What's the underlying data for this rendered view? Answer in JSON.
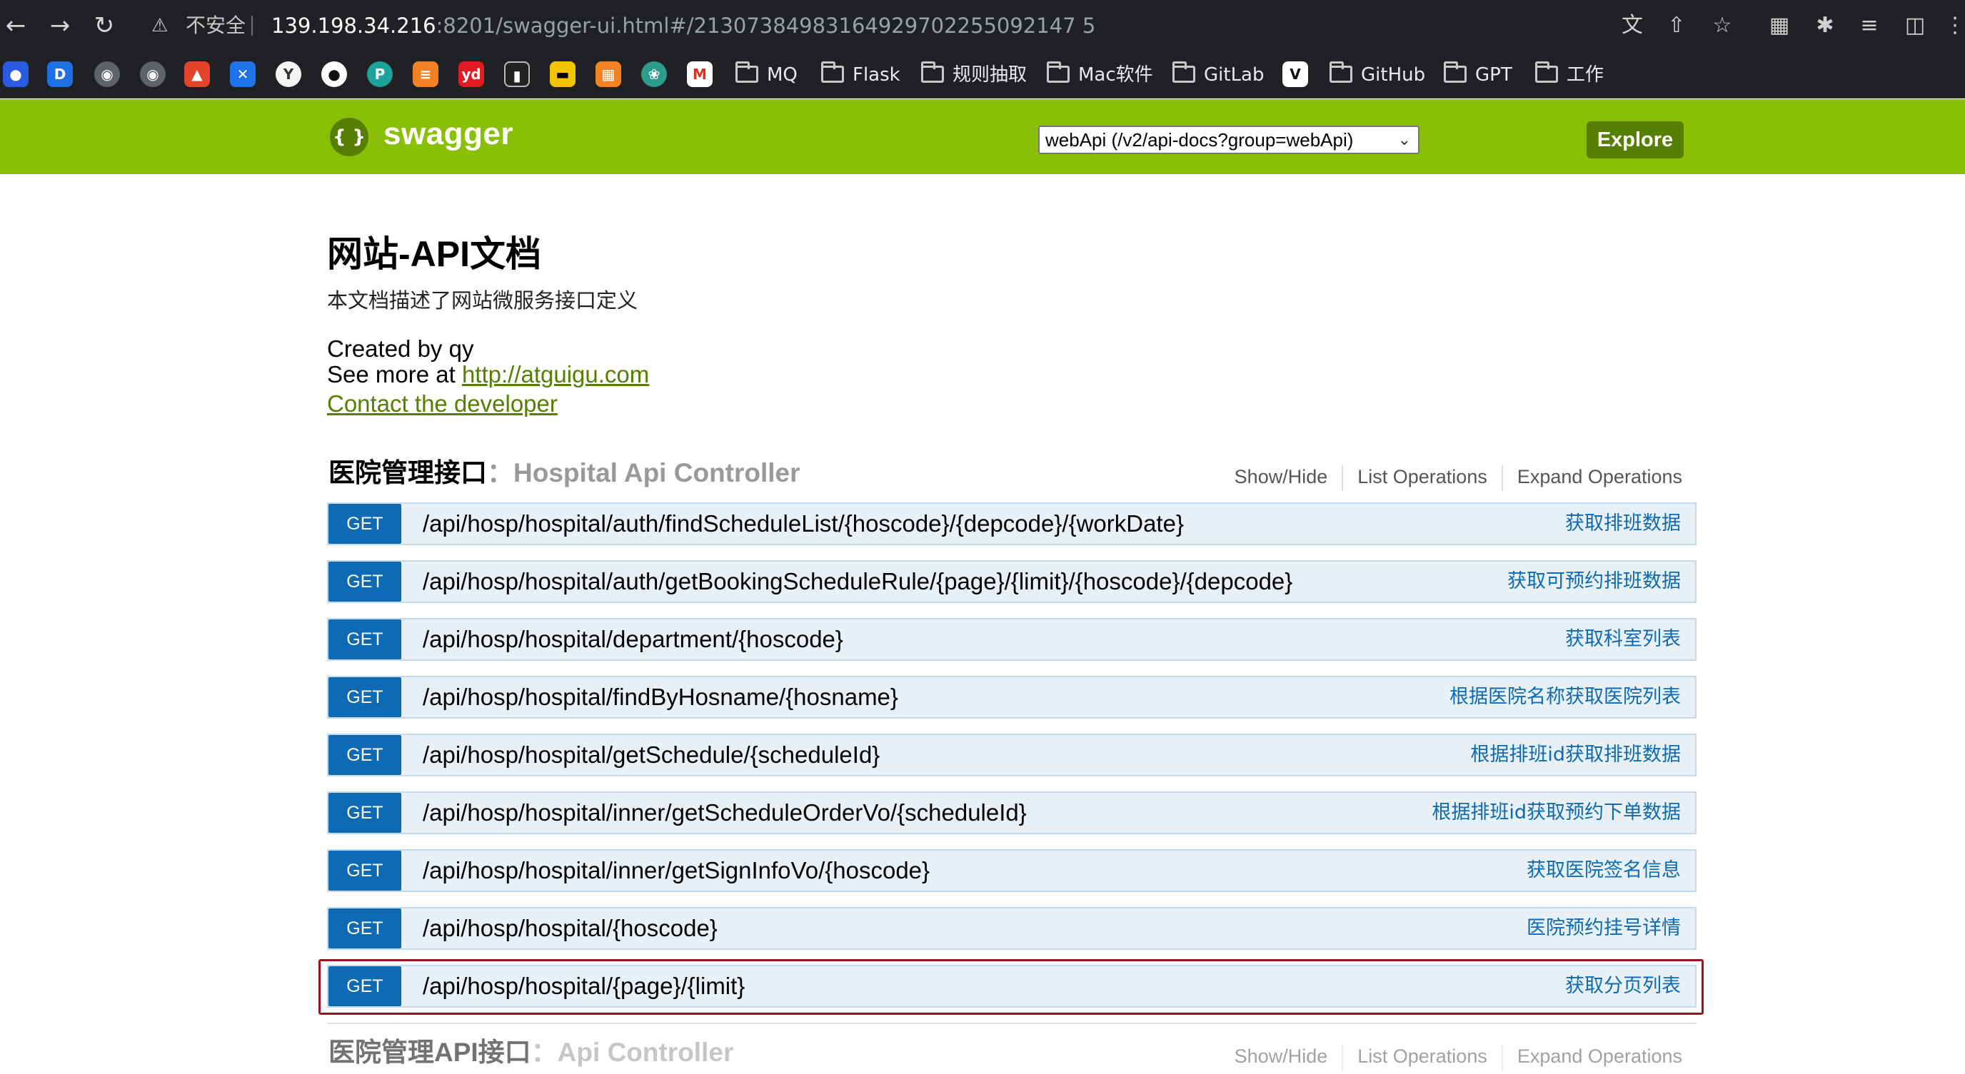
{
  "browser": {
    "insecure_label": "不安全",
    "url_host": "139.198.34.216",
    "url_rest": ":8201/swagger-ui.html#/21307384983164929702255092147 5",
    "bookmarks": {
      "folders": [
        "MQ",
        "Flask",
        "规则抽取",
        "Mac软件",
        "GitLab",
        "GitHub",
        "GPT",
        "工作"
      ]
    }
  },
  "swagger": {
    "logo_text": "swagger",
    "logo_mark": "{ }",
    "api_select_value": "webApi (/v2/api-docs?group=webApi)",
    "explore_label": "Explore"
  },
  "info": {
    "title": "网站-API文档",
    "description": "本文档描述了网站微服务接口定义",
    "created_by": "Created by qy",
    "see_more_prefix": "See more at ",
    "see_more_link": "http://atguigu.com",
    "contact": "Contact the developer"
  },
  "resources": [
    {
      "name_cn": "医院管理接口",
      "name_en": "：Hospital Api Controller",
      "show_hide": "Show/Hide",
      "list_operations": "List Operations",
      "expand_operations": "Expand Operations",
      "operations": [
        {
          "method": "GET",
          "path": "/api/hosp/hospital/auth/findScheduleList/{hoscode}/{depcode}/{workDate}",
          "summary": "获取排班数据"
        },
        {
          "method": "GET",
          "path": "/api/hosp/hospital/auth/getBookingScheduleRule/{page}/{limit}/{hoscode}/{depcode}",
          "summary": "获取可预约排班数据"
        },
        {
          "method": "GET",
          "path": "/api/hosp/hospital/department/{hoscode}",
          "summary": "获取科室列表"
        },
        {
          "method": "GET",
          "path": "/api/hosp/hospital/findByHosname/{hosname}",
          "summary": "根据医院名称获取医院列表"
        },
        {
          "method": "GET",
          "path": "/api/hosp/hospital/getSchedule/{scheduleId}",
          "summary": "根据排班id获取排班数据"
        },
        {
          "method": "GET",
          "path": "/api/hosp/hospital/inner/getScheduleOrderVo/{scheduleId}",
          "summary": "根据排班id获取预约下单数据"
        },
        {
          "method": "GET",
          "path": "/api/hosp/hospital/inner/getSignInfoVo/{hoscode}",
          "summary": "获取医院签名信息"
        },
        {
          "method": "GET",
          "path": "/api/hosp/hospital/{hoscode}",
          "summary": "医院预约挂号详情"
        },
        {
          "method": "GET",
          "path": "/api/hosp/hospital/{page}/{limit}",
          "summary": "获取分页列表"
        }
      ]
    },
    {
      "name_cn": "医院管理API接口",
      "name_en": "：Api Controller",
      "show_hide": "Show/Hide",
      "list_operations": "List Operations",
      "expand_operations": "Expand Operations"
    }
  ]
}
